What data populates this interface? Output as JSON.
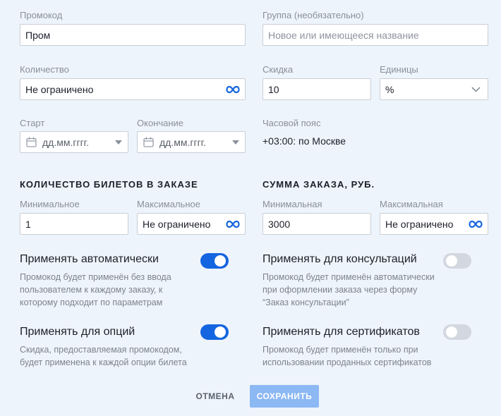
{
  "promo": {
    "code_label": "Промокод",
    "code_value": "Пром",
    "group_label": "Группа (необязательно)",
    "group_placeholder": "Новое или имеющееся название"
  },
  "quantity": {
    "label": "Количество",
    "value": "Не ограничено",
    "icon": "infinity-icon"
  },
  "discount": {
    "label": "Скидка",
    "value": "10",
    "units_label": "Единицы",
    "units_value": "%"
  },
  "dates": {
    "start_label": "Старт",
    "start_placeholder": "дд.мм.гггг.",
    "end_label": "Окончание",
    "end_placeholder": "дд.мм.гггг."
  },
  "timezone": {
    "label": "Часовой пояс",
    "value": "+03:00: по Москве"
  },
  "tickets": {
    "title": "КОЛИЧЕСТВО БИЛЕТОВ В ЗАКАЗЕ",
    "min_label": "Минимальное",
    "min_value": "1",
    "max_label": "Максимальное",
    "max_value": "Не ограничено"
  },
  "order_sum": {
    "title": "СУММА ЗАКАЗА, РУБ.",
    "min_label": "Минимальная",
    "min_value": "3000",
    "max_label": "Максимальная",
    "max_value": "Не ограничено"
  },
  "toggles": {
    "auto": {
      "title": "Применять автоматически",
      "desc1": "Промокод будет применён без ввода",
      "desc2": "пользователем к каждому заказу, к",
      "desc3": "которому подходит по параметрам",
      "on": true
    },
    "consult": {
      "title": "Применять для консультаций",
      "desc1": "Промокод будет применён автоматически",
      "desc2": "при оформлении заказа через форму",
      "desc3": "“Заказ консультации”",
      "on": false
    },
    "options": {
      "title": "Применять для опций",
      "desc1": "Скидка, предоставляемая промокодом,",
      "desc2": "будет применена к каждой опции билета",
      "on": true
    },
    "certs": {
      "title": "Применять для сертификатов",
      "desc1": "Промокод будет применён только при",
      "desc2": "использовании проданных сертификатов",
      "on": false
    }
  },
  "actions": {
    "cancel": "ОТМЕНА",
    "save": "СОХРАНИТЬ"
  },
  "colors": {
    "accent": "#1565e0",
    "save_disabled": "#8cb8f3",
    "background": "#eef4fb"
  }
}
